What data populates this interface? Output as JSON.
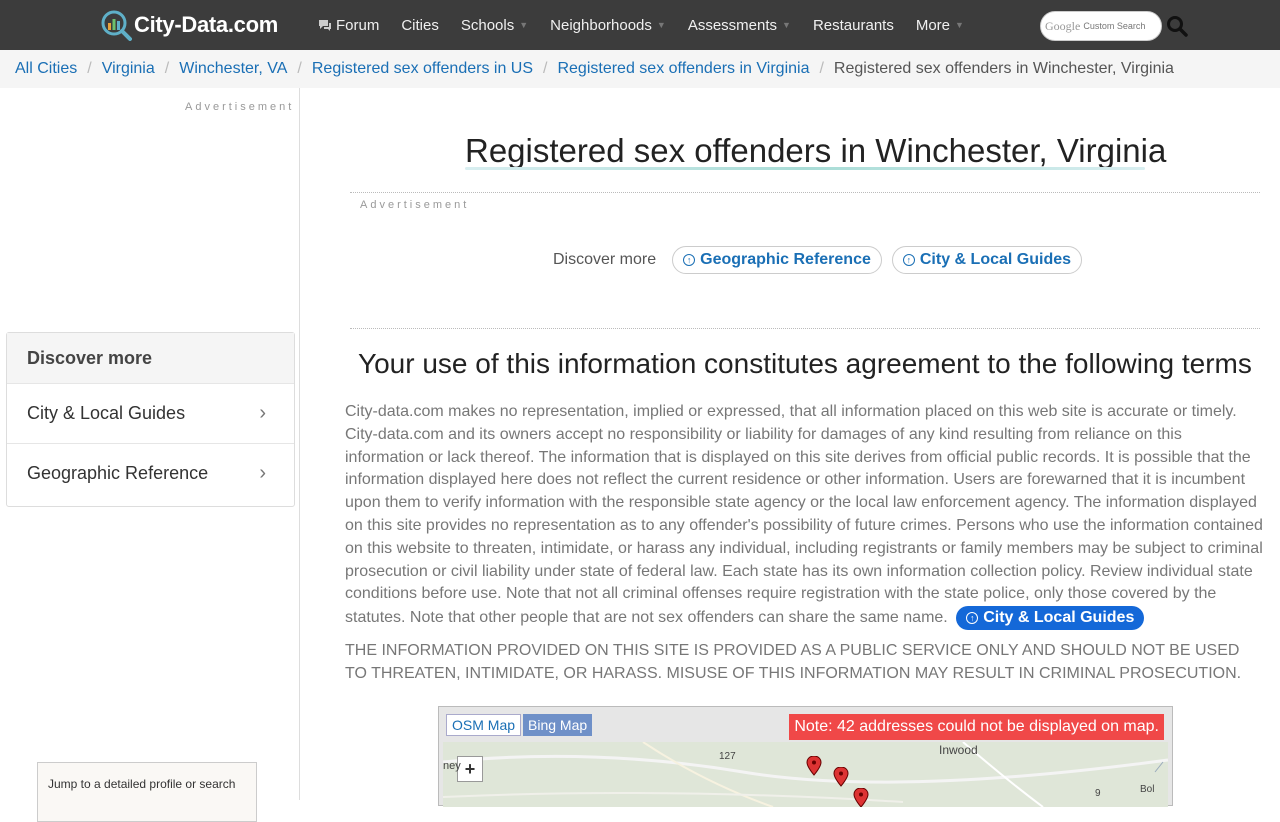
{
  "header": {
    "logo_text": "City-Data.com",
    "nav": [
      {
        "label": "Forum",
        "icon": "chat-icon",
        "caret": false
      },
      {
        "label": "Cities",
        "caret": false
      },
      {
        "label": "Schools",
        "caret": true
      },
      {
        "label": "Neighborhoods",
        "caret": true
      },
      {
        "label": "Assessments",
        "caret": true
      },
      {
        "label": "Restaurants",
        "caret": false
      },
      {
        "label": "More",
        "caret": true
      }
    ],
    "search_brand": "Google",
    "search_placeholder": "Custom Search"
  },
  "breadcrumb": [
    "All Cities",
    "Virginia",
    "Winchester, VA",
    "Registered sex offenders in US",
    "Registered sex offenders in Virginia",
    "Registered sex offenders in Winchester, Virginia"
  ],
  "sidebar": {
    "ad_label": "Advertisement",
    "discover_title": "Discover more",
    "discover_items": [
      "City & Local Guides",
      "Geographic Reference"
    ],
    "jump_text": "Jump to a detailed profile or search"
  },
  "main": {
    "title": "Registered sex offenders in Winchester, Virginia",
    "ad_label": "Advertisement",
    "discover_label": "Discover more",
    "discover_pills": [
      "Geographic Reference",
      "City & Local Guides"
    ],
    "terms_title": "Your use of this information constitutes agreement to the following terms",
    "terms_body": "City-data.com makes no representation, implied or expressed, that all information placed on this web site is accurate or timely. City-data.com and its owners accept no responsibility or liability for damages of any kind resulting from reliance on this information or lack thereof. The information that is displayed on this site derives from official public records. It is possible that the information displayed here does not reflect the current residence or other information. Users are forewarned that it is incumbent upon them to verify information with the responsible state agency or the local law enforcement agency. The information displayed on this site provides no representation as to any offender's possibility of future crimes. Persons who use the information contained on this website to threaten, intimidate, or harass any individual, including registrants or family members may be subject to criminal prosecution or civil liability under state of federal law. Each state has its own information collection policy. Review individual state conditions before use. Note that not all criminal offenses require registration with the state police, only those covered by the statutes. Note that other people that are not sex offenders can share the same name.",
    "inline_pill": "City & Local Guides",
    "caps_body": "THE INFORMATION PROVIDED ON THIS SITE IS PROVIDED AS A PUBLIC SERVICE ONLY AND SHOULD NOT BE USED TO THREATEN, INTIMIDATE, OR HARASS. MISUSE OF THIS INFORMATION MAY RESULT IN CRIMINAL PROSECUTION."
  },
  "map": {
    "tab_osm": "OSM Map",
    "tab_bing": "Bing Map",
    "note": "Note: 42 addresses could not be displayed on map.",
    "labels": [
      "Inwood",
      "127",
      "ney",
      "9",
      "Bol"
    ],
    "zoom_in": "+"
  }
}
